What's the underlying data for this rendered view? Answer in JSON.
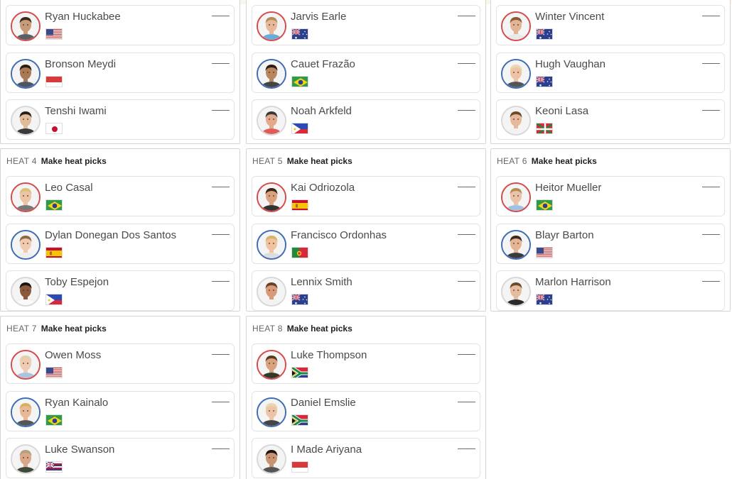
{
  "heats": [
    {
      "label": "",
      "picks": "",
      "surfers": [
        {
          "name": "Ryan Huckabee",
          "flag": "usa",
          "jersey": "red",
          "score": "——",
          "skin": "#c89a78",
          "hair": "#3a2a1e",
          "shirt": "#5a6068"
        },
        {
          "name": "Bronson Meydi",
          "flag": "indonesia",
          "jersey": "blue",
          "score": "——",
          "skin": "#a97a55",
          "hair": "#2a1e14",
          "shirt": "#4b5563"
        },
        {
          "name": "Tenshi Iwami",
          "flag": "japan",
          "jersey": "white",
          "score": "——",
          "skin": "#e2bb98",
          "hair": "#2b2018",
          "shirt": "#3a3a3a"
        }
      ]
    },
    {
      "label": "",
      "picks": "",
      "surfers": [
        {
          "name": "Jarvis Earle",
          "flag": "australia",
          "jersey": "red",
          "score": "——",
          "skin": "#e7b89a",
          "hair": "#b58a5a",
          "shirt": "#6fa9d8"
        },
        {
          "name": "Cauet Frazão",
          "flag": "brazil",
          "jersey": "blue",
          "score": "——",
          "skin": "#b9875f",
          "hair": "#2b1d12",
          "shirt": "#444"
        },
        {
          "name": "Noah Arkfeld",
          "flag": "philippines",
          "jersey": "white",
          "score": "——",
          "skin": "#e2aa8a",
          "hair": "#3a3a3a",
          "shirt": "#e25b5b"
        }
      ]
    },
    {
      "label": "",
      "picks": "",
      "surfers": [
        {
          "name": "Winter Vincent",
          "flag": "australia",
          "jersey": "red",
          "score": "——",
          "skin": "#e1b495",
          "hair": "#8a5a35",
          "shirt": "#e9e9e9"
        },
        {
          "name": "Hugh Vaughan",
          "flag": "australia",
          "jersey": "blue",
          "score": "——",
          "skin": "#eec3a3",
          "hair": "#e8d9b5",
          "shirt": "#555"
        },
        {
          "name": "Keoni Lasa",
          "flag": "basque",
          "jersey": "white",
          "score": "——",
          "skin": "#e5b999",
          "hair": "#6a4a2a",
          "shirt": "#f2f2f2"
        }
      ]
    },
    {
      "label": "HEAT 4",
      "picks": "Make heat picks",
      "surfers": [
        {
          "name": "Leo Casal",
          "flag": "brazil",
          "jersey": "red",
          "score": "——",
          "skin": "#ecc3a3",
          "hair": "#d9c07a",
          "shirt": "#777"
        },
        {
          "name": "Dylan Donegan Dos Santos",
          "flag": "spain",
          "jersey": "blue",
          "score": "——",
          "skin": "#f0c9ae",
          "hair": "#8a6a45",
          "shirt": "#eee"
        },
        {
          "name": "Toby Espejon",
          "flag": "philippines",
          "jersey": "white",
          "score": "——",
          "skin": "#8a5a3a",
          "hair": "#1e1410",
          "shirt": "#fafafa"
        }
      ]
    },
    {
      "label": "HEAT 5",
      "picks": "Make heat picks",
      "surfers": [
        {
          "name": "Kai Odriozola",
          "flag": "spain",
          "jersey": "red",
          "score": "——",
          "skin": "#d9a27c",
          "hair": "#3a2414",
          "shirt": "#333"
        },
        {
          "name": "Francisco Ordonhas",
          "flag": "portugal",
          "jersey": "blue",
          "score": "——",
          "skin": "#f0c39e",
          "hair": "#d6b46a",
          "shirt": "#ddd"
        },
        {
          "name": "Lennix Smith",
          "flag": "australia",
          "jersey": "white",
          "score": "——",
          "skin": "#d99a7a",
          "hair": "#6a4028",
          "shirt": "#f2f2f2"
        }
      ]
    },
    {
      "label": "HEAT 6",
      "picks": "Make heat picks",
      "surfers": [
        {
          "name": "Heitor Mueller",
          "flag": "brazil",
          "jersey": "red",
          "score": "——",
          "skin": "#eac2a5",
          "hair": "#b48a55",
          "shirt": "#9fc2e4"
        },
        {
          "name": "Blayr Barton",
          "flag": "usa",
          "jersey": "blue",
          "score": "——",
          "skin": "#e4b493",
          "hair": "#3a2a1e",
          "shirt": "#3a3a3a"
        },
        {
          "name": "Marlon Harrison",
          "flag": "australia",
          "jersey": "white",
          "score": "——",
          "skin": "#e7bc9d",
          "hair": "#6a4a2a",
          "shirt": "#2a2a2a"
        }
      ]
    },
    {
      "label": "HEAT 7",
      "picks": "Make heat picks",
      "surfers": [
        {
          "name": "Owen Moss",
          "flag": "usa",
          "jersey": "red",
          "score": "——",
          "skin": "#f0cbb1",
          "hair": "#e0cfa8",
          "shirt": "#aac4e0"
        },
        {
          "name": "Ryan Kainalo",
          "flag": "brazil",
          "jersey": "blue",
          "score": "——",
          "skin": "#e9b996",
          "hair": "#d4b060",
          "shirt": "#555"
        },
        {
          "name": "Luke Swanson",
          "flag": "hawaii",
          "jersey": "white",
          "score": "——",
          "skin": "#d9a888",
          "hair": "#b0a080",
          "shirt": "#3f4a3a"
        }
      ]
    },
    {
      "label": "HEAT 8",
      "picks": "Make heat picks",
      "surfers": [
        {
          "name": "Luke Thompson",
          "flag": "southafrica",
          "jersey": "red",
          "score": "——",
          "skin": "#d8a27e",
          "hair": "#5a3a22",
          "shirt": "#2f3a2a"
        },
        {
          "name": "Daniel Emslie",
          "flag": "southafrica",
          "jersey": "blue",
          "score": "——",
          "skin": "#ecc4a6",
          "hair": "#e6d7ae",
          "shirt": "#444"
        },
        {
          "name": "I Made Ariyana",
          "flag": "indonesia",
          "jersey": "white",
          "score": "——",
          "skin": "#c89472",
          "hair": "#1e1410",
          "shirt": "#555"
        }
      ]
    }
  ]
}
